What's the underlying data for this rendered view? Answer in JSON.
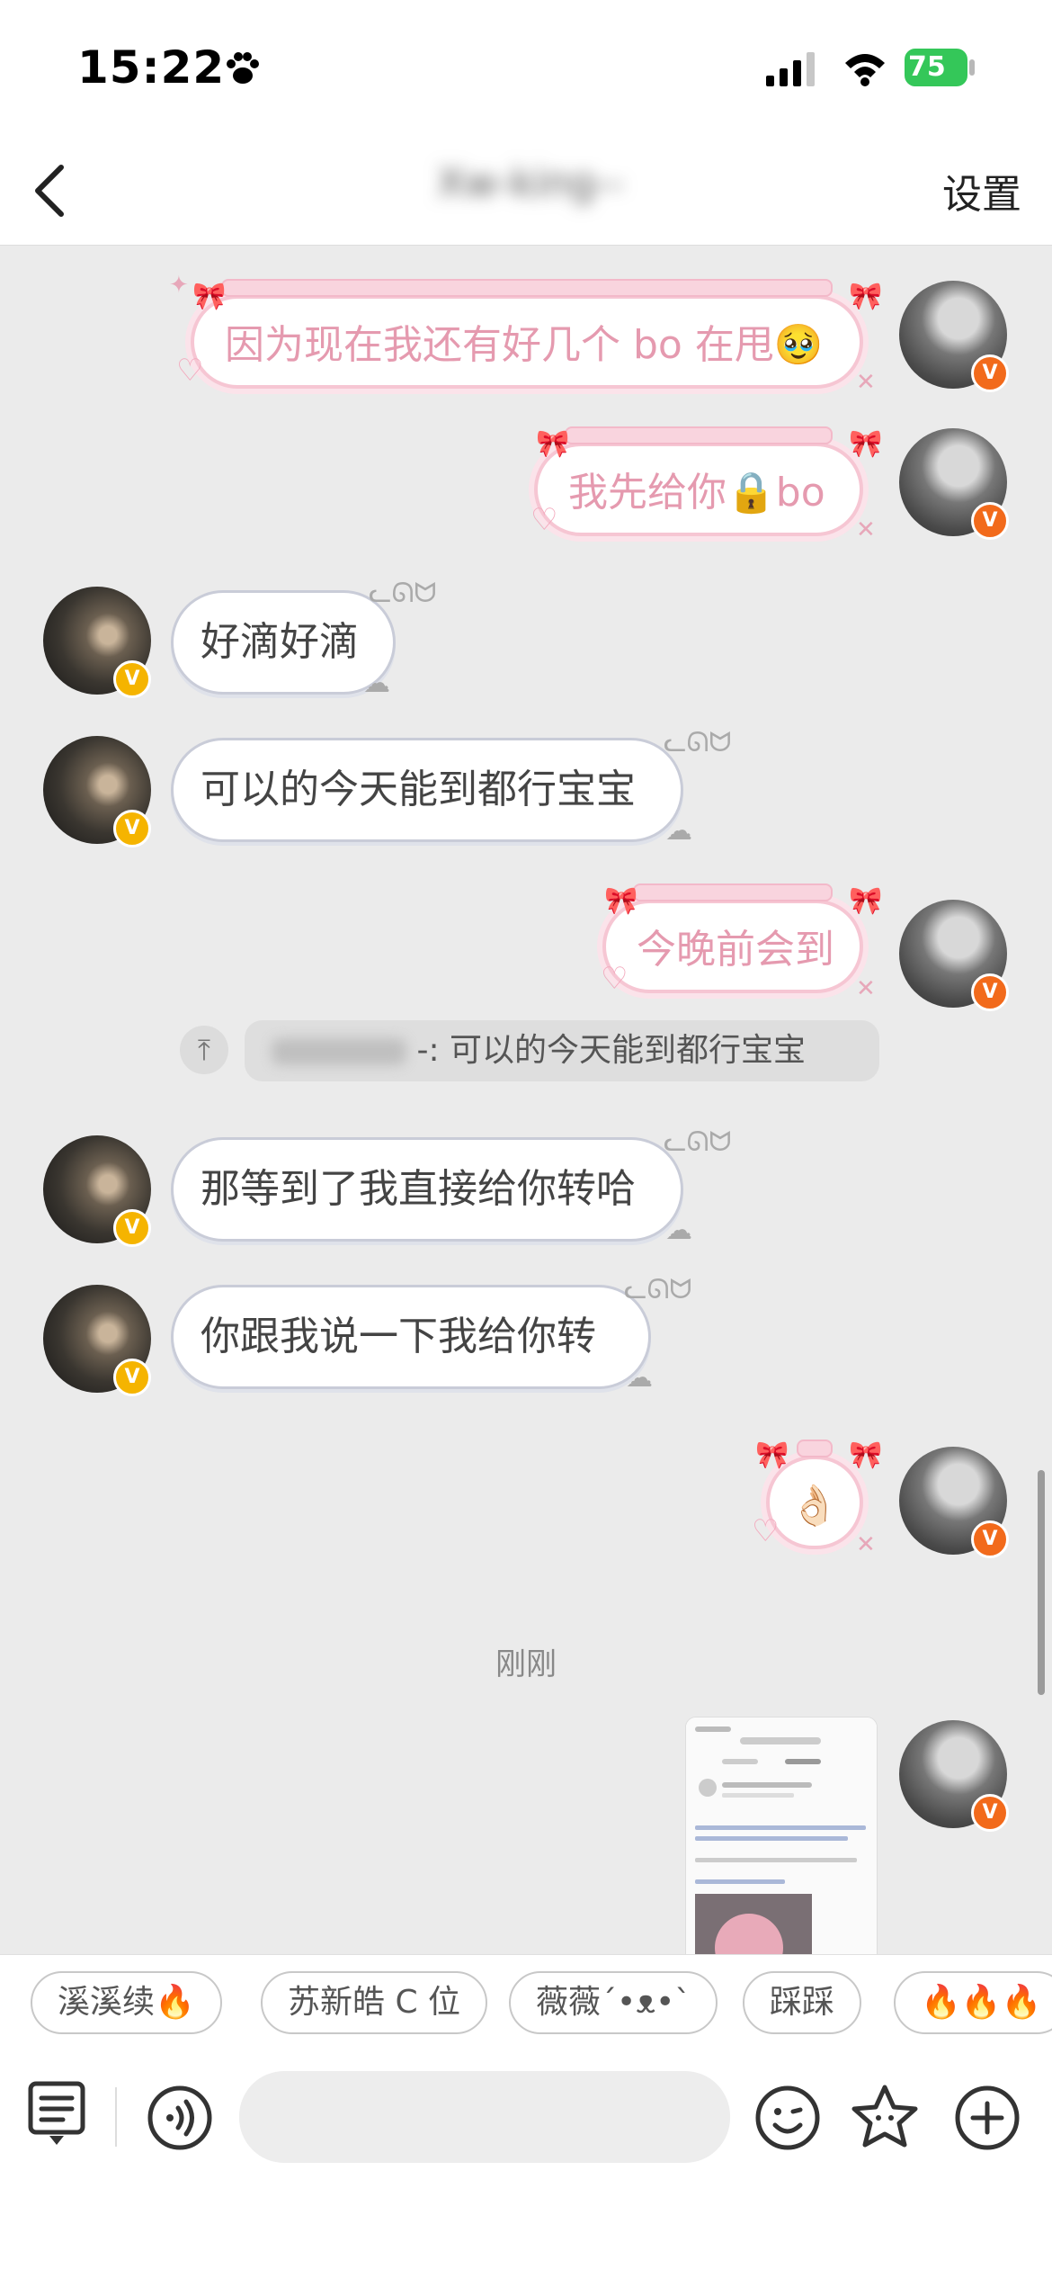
{
  "status_bar": {
    "time": "15:22",
    "battery": "75"
  },
  "nav": {
    "title": "Xw-king--",
    "settings": "设置"
  },
  "messages": [
    {
      "side": "right",
      "style": "pink",
      "text": "因为现在我还有好几个 bo 在甩🥹"
    },
    {
      "side": "right",
      "style": "pink",
      "text": "我先给你🔒bo"
    },
    {
      "side": "left",
      "style": "white",
      "text": "好滴好滴"
    },
    {
      "side": "left",
      "style": "white",
      "text": "可以的今天能到都行宝宝"
    },
    {
      "side": "right",
      "style": "pink",
      "text": "今晚前会到"
    },
    {
      "side": "left",
      "style": "white",
      "text": "那等到了我直接给你转哈"
    },
    {
      "side": "left",
      "style": "white",
      "text": "你跟我说一下我给你转"
    },
    {
      "side": "right",
      "style": "pink",
      "text": "👌🏻"
    }
  ],
  "quote": {
    "text": "-: 可以的今天能到都行宝宝"
  },
  "timestamp": "刚刚",
  "quick_replies": [
    "溪溪续🔥",
    "苏新皓 C 位",
    "薇薇´•ᴥ•`",
    "踩踩",
    "🔥🔥🔥"
  ],
  "input": {
    "placeholder": ""
  },
  "colors": {
    "accent_badge": "#f26a1b",
    "verified_yellow": "#f5b400",
    "pink_border": "#f6c6d3",
    "battery": "#34c759"
  },
  "icons": {
    "status": [
      "paw-icon",
      "signal-icon",
      "wifi-icon",
      "battery-icon"
    ],
    "nav": [
      "back-arrow-icon"
    ],
    "input_bar": [
      "menu-icon",
      "voice-icon",
      "emoji-icon",
      "sticker-icon",
      "add-icon"
    ]
  }
}
